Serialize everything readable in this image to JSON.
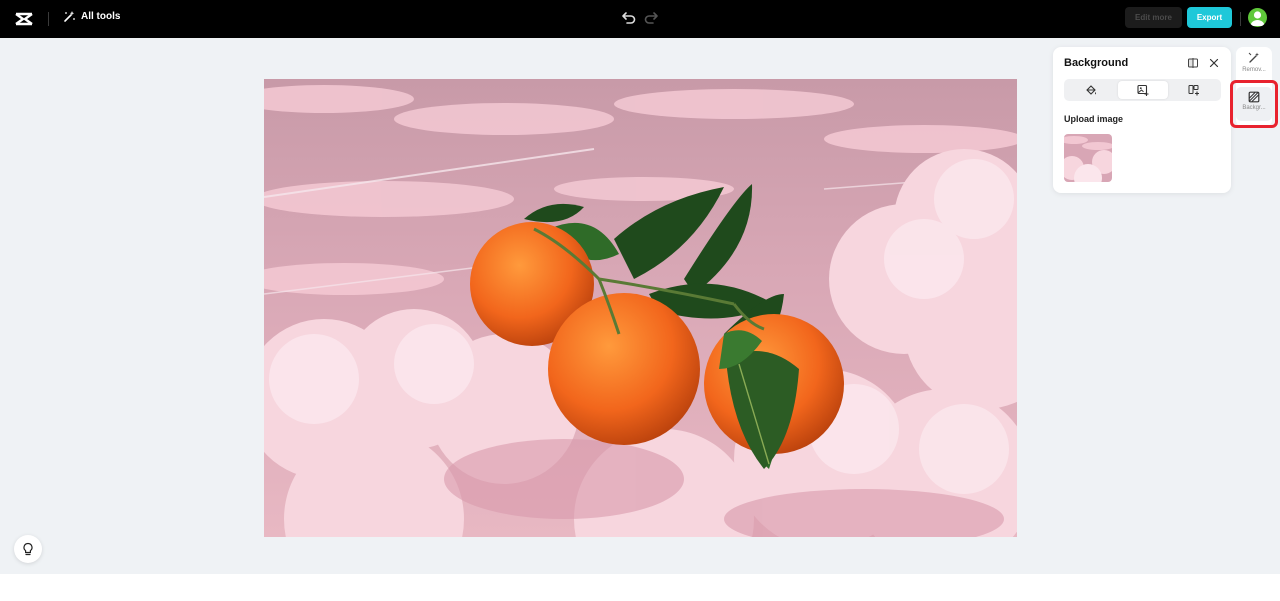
{
  "topbar": {
    "all_tools_label": "All tools",
    "edit_more_label": "Edit more",
    "export_label": "Export",
    "accent_color": "#1ec8d9"
  },
  "panel": {
    "title": "Background",
    "upload_label": "Upload image",
    "tabs": [
      {
        "icon": "paint-bucket-icon"
      },
      {
        "icon": "image-add-icon"
      },
      {
        "icon": "template-add-icon"
      }
    ]
  },
  "rail": {
    "items": [
      {
        "label": "Remov...",
        "icon": "magic-wand-icon"
      },
      {
        "label": "Backgr...",
        "icon": "background-icon"
      }
    ]
  }
}
